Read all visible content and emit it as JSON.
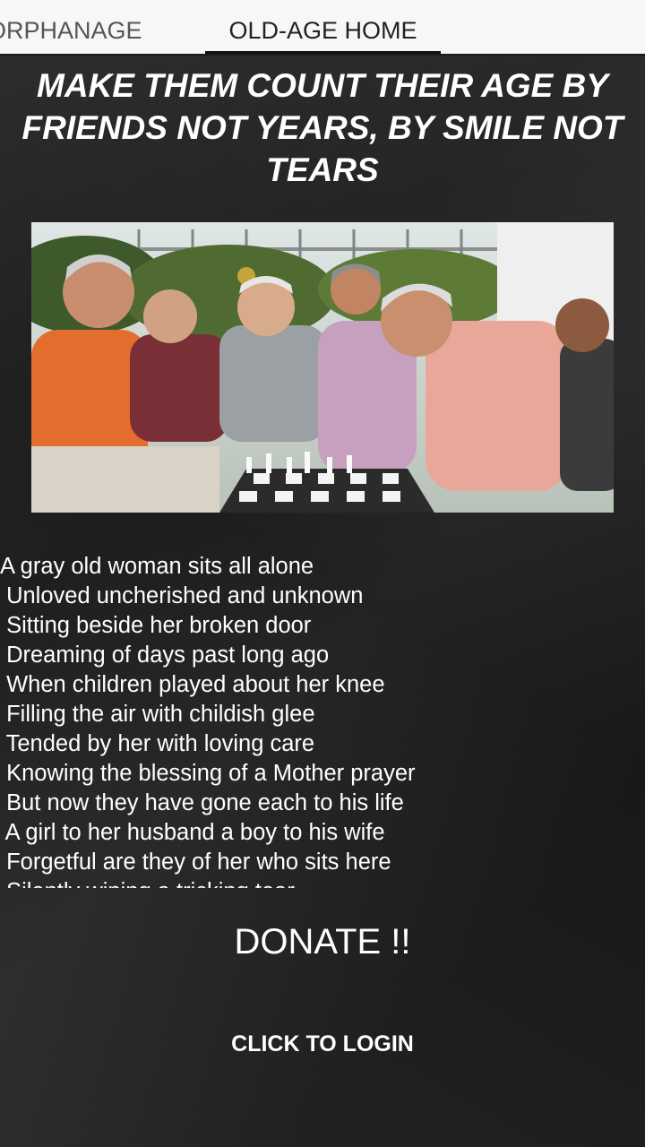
{
  "tabs": [
    {
      "label": "ORPHANAGE"
    },
    {
      "label": "OLD-AGE HOME"
    }
  ],
  "heading": "MAKE THEM COUNT THEIR AGE BY FRIENDS NOT YEARS, BY SMILE NOT TEARS",
  "poem": [
    "A gray old woman sits all alone",
    " Unloved uncherished and unknown",
    " Sitting beside her broken door",
    " Dreaming of days past long ago",
    " When children played about her knee",
    " Filling the air with childish glee",
    " Tended by her with loving care",
    " Knowing the blessing of a Mother prayer",
    " But now they have gone each to his life",
    " A girl to her husband a boy to his wife",
    " Forgetful are they of her who sits here",
    " Silently wiping a tricking tear"
  ],
  "donate_label": "DONATE !!",
  "login_label": "CLICK TO LOGIN"
}
